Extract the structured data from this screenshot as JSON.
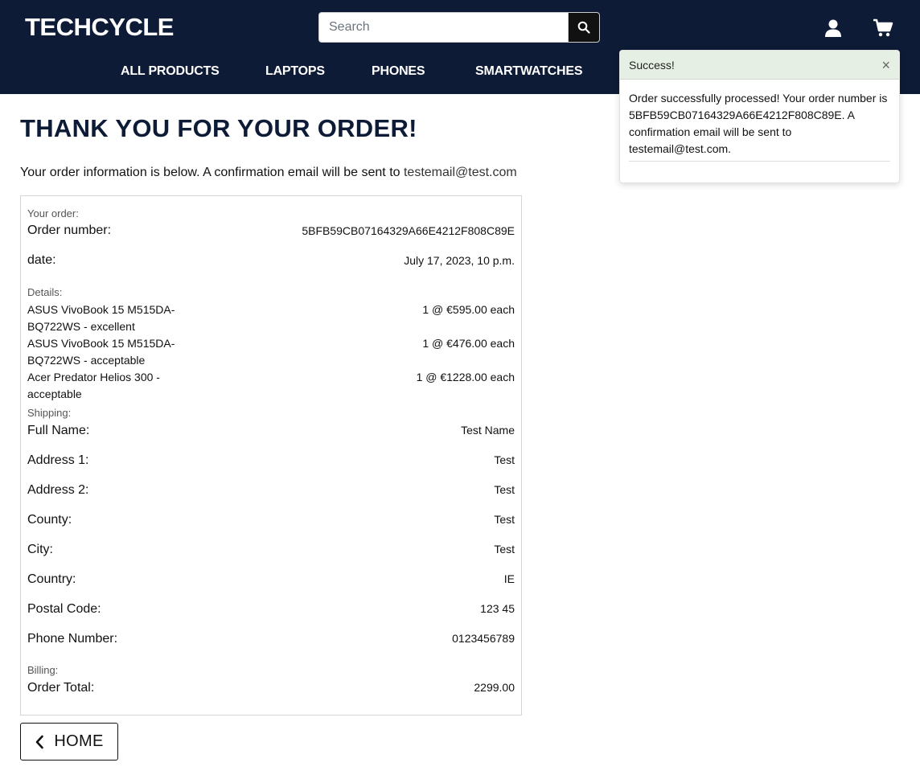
{
  "header": {
    "logo": "TECHCYCLE",
    "search_placeholder": "Search",
    "icons": {
      "search": "search-icon",
      "account": "user-icon",
      "cart": "cart-icon"
    }
  },
  "nav": {
    "all_products": "ALL PRODUCTS",
    "laptops": "LAPTOPS",
    "phones": "PHONES",
    "smartwatches": "SMARTWATCHES"
  },
  "toast": {
    "title": "Success!",
    "close": "×",
    "message": "Order successfully processed! Your order number is 5BFB59CB07164329A66E4212F808C89E. A confirmation email will be sent to testemail@test.com."
  },
  "page": {
    "title": "THANK YOU FOR YOUR ORDER!",
    "intro_text": "Your order information is below. A confirmation email will be sent to ",
    "intro_email": "testemail@test.com"
  },
  "order": {
    "section_label": "Your order:",
    "number_label": "Order number:",
    "number_value": "5BFB59CB07164329A66E4212F808C89E",
    "date_label": "date:",
    "date_value": "July 17, 2023, 10 p.m."
  },
  "details": {
    "section_label": "Details:",
    "items": [
      {
        "name": "ASUS VivoBook 15 M515DA-BQ722WS - excellent",
        "qty_price": "1 @ €595.00 each"
      },
      {
        "name": "ASUS VivoBook 15 M515DA-BQ722WS - acceptable",
        "qty_price": "1 @ €476.00 each"
      },
      {
        "name": "Acer Predator Helios 300 - acceptable",
        "qty_price": "1 @ €1228.00 each"
      }
    ]
  },
  "shipping": {
    "section_label": "Shipping:",
    "fields": [
      {
        "label": "Full Name:",
        "value": "Test Name"
      },
      {
        "label": "Address 1:",
        "value": "Test"
      },
      {
        "label": "Address 2:",
        "value": "Test"
      },
      {
        "label": "County:",
        "value": "Test"
      },
      {
        "label": "City:",
        "value": "Test"
      },
      {
        "label": "Country:",
        "value": "IE"
      },
      {
        "label": "Postal Code:",
        "value": "123 45"
      },
      {
        "label": "Phone Number:",
        "value": "0123456789"
      }
    ]
  },
  "billing": {
    "section_label": "Billing:",
    "total_label": "Order Total:",
    "total_value": "2299.00"
  },
  "home_button": {
    "label": "HOME",
    "icon": "chevron-left-icon"
  },
  "colors": {
    "header_bg": "#0d1b36",
    "toast_header_bg": "#e6efe4"
  }
}
